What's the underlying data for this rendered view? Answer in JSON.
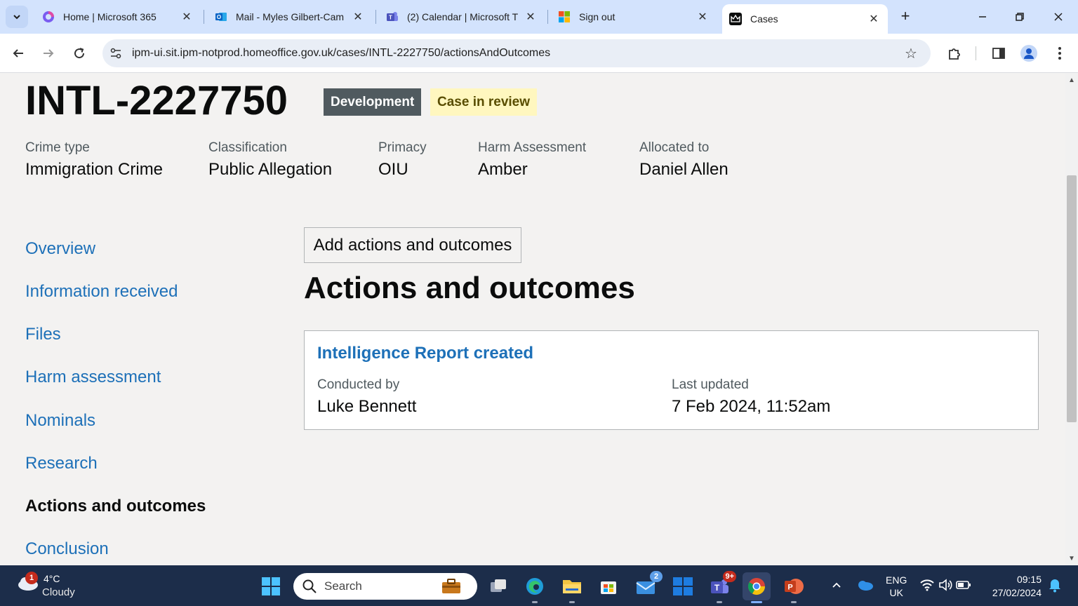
{
  "browser": {
    "tabs": [
      {
        "label": "Home | Microsoft 365",
        "icon": "microsoft-365-icon"
      },
      {
        "label": "Mail - Myles Gilbert-Cam",
        "icon": "outlook-icon"
      },
      {
        "label": "(2) Calendar | Microsoft T",
        "icon": "teams-icon"
      },
      {
        "label": "Sign out",
        "icon": "microsoft-logo-icon"
      },
      {
        "label": "Cases",
        "icon": "crown-icon",
        "active": true
      }
    ],
    "url": "ipm-ui.sit.ipm-notprod.homeoffice.gov.uk/cases/INTL-2227750/actionsAndOutcomes"
  },
  "case": {
    "id": "INTL-2227750",
    "tags": {
      "environment": "Development",
      "status": "Case in review"
    },
    "meta": [
      {
        "label": "Crime type",
        "value": "Immigration Crime"
      },
      {
        "label": "Classification",
        "value": "Public Allegation"
      },
      {
        "label": "Primacy",
        "value": "OIU"
      },
      {
        "label": "Harm Assessment",
        "value": "Amber"
      },
      {
        "label": "Allocated to",
        "value": "Daniel Allen"
      }
    ]
  },
  "nav": [
    {
      "label": "Overview"
    },
    {
      "label": "Information received"
    },
    {
      "label": "Files"
    },
    {
      "label": "Harm assessment"
    },
    {
      "label": "Nominals"
    },
    {
      "label": "Research"
    },
    {
      "label": "Actions and outcomes",
      "current": true
    },
    {
      "label": "Conclusion"
    }
  ],
  "main": {
    "add_button": "Add actions and outcomes",
    "title": "Actions and outcomes",
    "card": {
      "title": "Intelligence Report created",
      "conducted_label": "Conducted by",
      "conducted_value": "Luke Bennett",
      "updated_label": "Last updated",
      "updated_value": "7 Feb 2024, 11:52am"
    }
  },
  "taskbar": {
    "weather": {
      "badge": "1",
      "temp": "4°C",
      "condition": "Cloudy"
    },
    "search_placeholder": "Search",
    "mail_badge": "2",
    "teams_badge": "9+",
    "lang": {
      "line1": "ENG",
      "line2": "UK"
    },
    "clock": {
      "time": "09:15",
      "date": "27/02/2024"
    }
  },
  "colors": {
    "link": "#1d70b8",
    "text": "#0b0c0c",
    "secondary_text": "#505a5f",
    "page_bg": "#f3f2f1",
    "tag_dev_bg": "#505a5f",
    "tag_review_bg": "#fff7bf",
    "tag_review_text": "#594d00",
    "tabstrip_bg": "#d3e3fd",
    "taskbar_bg": "#1c2d4a"
  }
}
